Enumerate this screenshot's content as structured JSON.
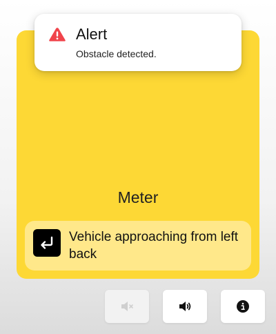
{
  "alert": {
    "icon": "warning-triangle-icon",
    "title": "Alert",
    "message": "Obstacle detected.",
    "icon_color": "#f0444b"
  },
  "card": {
    "background": "#fdd835",
    "label": "Meter",
    "notification": {
      "icon": "return-arrow-icon",
      "text": "Vehicle approaching from left back",
      "background": "#ffe88a"
    }
  },
  "controls": [
    {
      "name": "mute",
      "icon": "speaker-muted-icon",
      "disabled": true
    },
    {
      "name": "volume",
      "icon": "speaker-volume-icon",
      "disabled": false
    },
    {
      "name": "info",
      "icon": "info-icon",
      "disabled": false
    }
  ]
}
